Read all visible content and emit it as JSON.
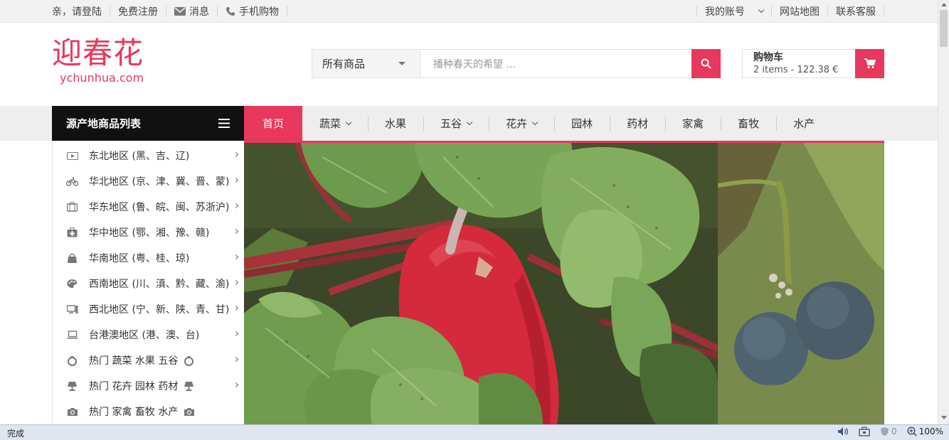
{
  "topbar": {
    "login": "亲，请登陆",
    "register": "免费注册",
    "messages": "消息",
    "mobile": "手机购物",
    "account": "我的账号",
    "sitemap": "网站地图",
    "support": "联系客服"
  },
  "header": {
    "logo_cn": "迎春花",
    "logo_en": "ychunhua.com",
    "search_category": "所有商品",
    "search_placeholder": "播种春天的希望 ...",
    "cart_title": "购物车",
    "cart_summary": "2 items - 122.38 €"
  },
  "nav": {
    "category_title": "源产地商品列表",
    "items": [
      {
        "label": "首页"
      },
      {
        "label": "蔬菜"
      },
      {
        "label": "水果"
      },
      {
        "label": "五谷"
      },
      {
        "label": "花卉"
      },
      {
        "label": "园林"
      },
      {
        "label": "药材"
      },
      {
        "label": "家禽"
      },
      {
        "label": "畜牧"
      },
      {
        "label": "水产"
      }
    ]
  },
  "sidebar": {
    "items": [
      {
        "label": "东北地区 (黑、吉、辽)",
        "icon": "play-screen-icon"
      },
      {
        "label": "华北地区 (京、津、冀、晋、蒙)",
        "icon": "bicycle-icon"
      },
      {
        "label": "华东地区 (鲁、皖、闽、苏浙沪)",
        "icon": "suitcase-icon"
      },
      {
        "label": "华中地区 (鄂、湘、豫、赣)",
        "icon": "medkit-icon"
      },
      {
        "label": "华南地区 (粤、桂、琼)",
        "icon": "shopping-bag-icon"
      },
      {
        "label": "西南地区 (川、滇、黔、藏、渝)",
        "icon": "palette-icon"
      },
      {
        "label": "西北地区 (宁、新、陕、青、甘)",
        "icon": "desktop-icon"
      },
      {
        "label": "台港澳地区 (港、澳、台)",
        "icon": "laptop-icon"
      },
      {
        "label": "热门  蔬菜  水果  五谷",
        "icon": "ring-icon"
      },
      {
        "label": "热门  花卉  园林  药材",
        "icon": "lamp-icon"
      },
      {
        "label": "热门  家禽  畜牧  水产",
        "icon": "camera-icon"
      }
    ]
  },
  "statusbar": {
    "status": "完成",
    "blocked_count": "0",
    "zoom": "100%"
  },
  "colors": {
    "accent": "#e8385d",
    "dark": "#111111"
  }
}
